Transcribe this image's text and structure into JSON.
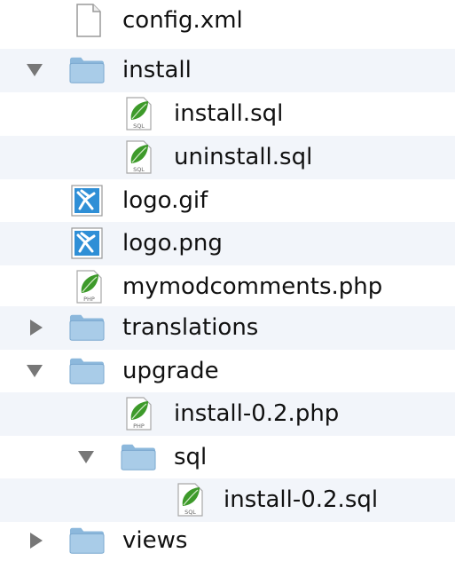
{
  "window_title": "",
  "tree": {
    "items": [
      {
        "label": "config.xml",
        "icon": "document-icon",
        "depth": 1,
        "expandable": false
      },
      {
        "label": "install",
        "icon": "folder-icon",
        "depth": 0,
        "expandable": true,
        "expanded": true
      },
      {
        "label": "install.sql",
        "icon": "sql-file-icon",
        "depth": 2,
        "expandable": false
      },
      {
        "label": "uninstall.sql",
        "icon": "sql-file-icon",
        "depth": 2,
        "expandable": false
      },
      {
        "label": "logo.gif",
        "icon": "image-file-icon",
        "depth": 1,
        "expandable": false
      },
      {
        "label": "logo.png",
        "icon": "image-file-icon",
        "depth": 1,
        "expandable": false
      },
      {
        "label": "mymodcomments.php",
        "icon": "php-file-icon",
        "depth": 1,
        "expandable": false
      },
      {
        "label": "translations",
        "icon": "folder-icon",
        "depth": 0,
        "expandable": true,
        "expanded": false
      },
      {
        "label": "upgrade",
        "icon": "folder-icon",
        "depth": 0,
        "expandable": true,
        "expanded": true
      },
      {
        "label": "install-0.2.php",
        "icon": "php-file-icon",
        "depth": 2,
        "expandable": false
      },
      {
        "label": "sql",
        "icon": "folder-icon",
        "depth": 1,
        "expandable": true,
        "expanded": true
      },
      {
        "label": "install-0.2.sql",
        "icon": "sql-file-icon",
        "depth": 3,
        "expandable": false
      },
      {
        "label": "views",
        "icon": "folder-icon",
        "depth": 0,
        "expandable": true,
        "expanded": false
      }
    ],
    "badges": {
      "sql": "SQL",
      "php": "PHP"
    }
  },
  "colors": {
    "alt_row": "#f2f5fa",
    "folder_body": "#a9cce8",
    "folder_tab": "#8cb8dc",
    "leaf_green": "#3d9a2a",
    "image_blue": "#2f8fd6",
    "disclosure": "#777777"
  }
}
